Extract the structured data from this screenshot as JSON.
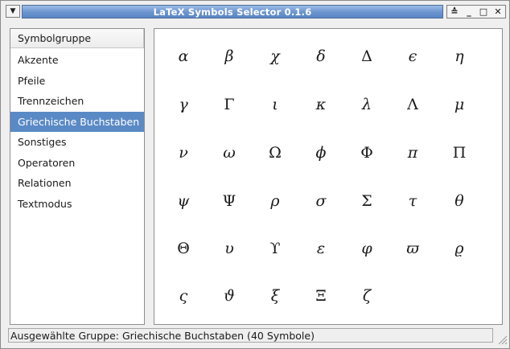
{
  "window": {
    "title": "LaTeX Symbols Selector 0.1.6",
    "menu_icon": "▼",
    "controls": [
      "≙",
      "_",
      "□",
      "✕"
    ]
  },
  "sidebar": {
    "header": "Symbolgruppe",
    "items": [
      {
        "label": "Akzente",
        "selected": false
      },
      {
        "label": "Pfeile",
        "selected": false
      },
      {
        "label": "Trennzeichen",
        "selected": false
      },
      {
        "label": "Griechische Buchstaben",
        "selected": true
      },
      {
        "label": "Sonstiges",
        "selected": false
      },
      {
        "label": "Operatoren",
        "selected": false
      },
      {
        "label": "Relationen",
        "selected": false
      },
      {
        "label": "Textmodus",
        "selected": false
      }
    ]
  },
  "symbols": [
    [
      "α",
      "β",
      "χ",
      "δ",
      "Δ",
      "ϵ",
      "η"
    ],
    [
      "γ",
      "Γ",
      "ι",
      "κ",
      "λ",
      "Λ",
      "μ"
    ],
    [
      "ν",
      "ω",
      "Ω",
      "ϕ",
      "Φ",
      "π",
      "Π"
    ],
    [
      "ψ",
      "Ψ",
      "ρ",
      "σ",
      "Σ",
      "τ",
      "θ"
    ],
    [
      "Θ",
      "υ",
      "ϒ",
      "ε",
      "φ",
      "ϖ",
      "ϱ"
    ],
    [
      "ς",
      "ϑ",
      "ξ",
      "Ξ",
      "ζ"
    ]
  ],
  "status": {
    "text": "Ausgewählte Gruppe: Griechische Buchstaben (40 Symbole)"
  }
}
